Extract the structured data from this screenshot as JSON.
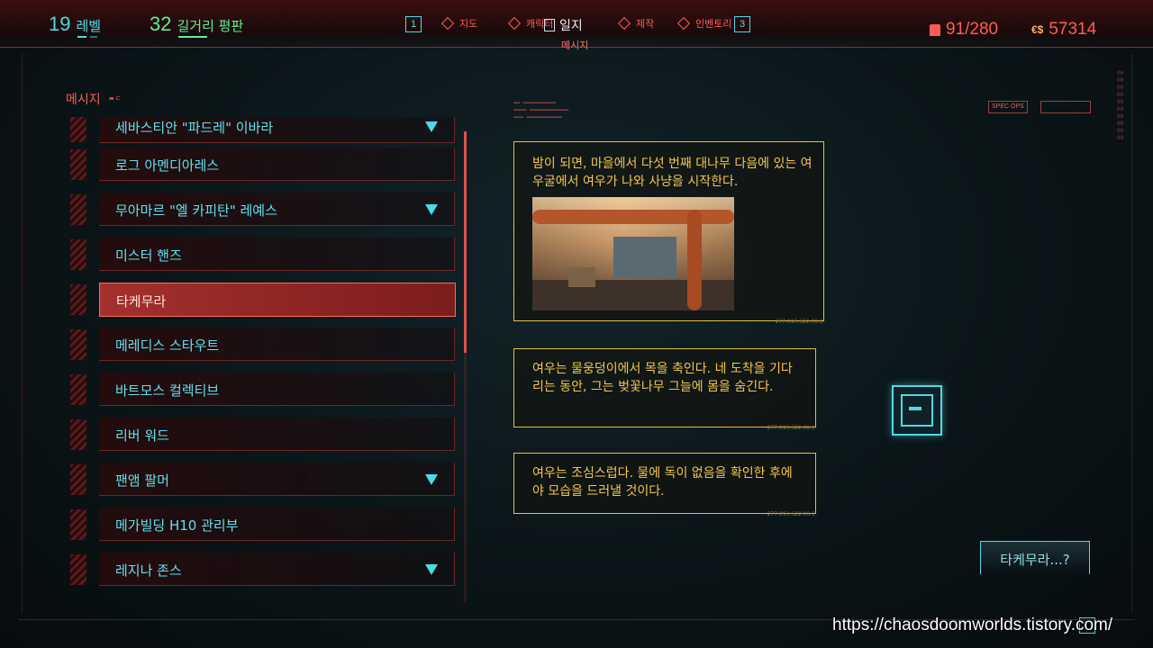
{
  "topbar": {
    "level": {
      "value": "19",
      "label": "레벨"
    },
    "street_cred": {
      "value": "32",
      "label": "길거리 평판"
    },
    "key_left": "1",
    "key_right": "3",
    "nav": [
      {
        "label": "지도",
        "icon": "map-diamond-icon"
      },
      {
        "label": "캐릭터",
        "icon": "character-icon"
      },
      {
        "label": "제작",
        "icon": "crafting-icon"
      },
      {
        "label": "인벤토리",
        "icon": "inventory-icon"
      }
    ],
    "active_tab": "일지",
    "active_sub": "메시지",
    "carry_weight": "91/280",
    "money_symbol": "€$",
    "money": "57314"
  },
  "messages_panel": {
    "title": "메시지",
    "contacts": [
      {
        "name": "세바스티안 \"파드레\" 이바라",
        "has_arrow": true,
        "selected": false
      },
      {
        "name": "로그 아멘디아레스",
        "has_arrow": false,
        "selected": false
      },
      {
        "name": "무아마르 \"엘 카피탄\" 레예스",
        "has_arrow": true,
        "selected": false
      },
      {
        "name": "미스터 핸즈",
        "has_arrow": false,
        "selected": false
      },
      {
        "name": "타케무라",
        "has_arrow": false,
        "selected": true
      },
      {
        "name": "메레디스 스타우트",
        "has_arrow": false,
        "selected": false
      },
      {
        "name": "바트모스 컬렉티브",
        "has_arrow": false,
        "selected": false
      },
      {
        "name": "리버 워드",
        "has_arrow": false,
        "selected": false
      },
      {
        "name": "팬앰 팔머",
        "has_arrow": true,
        "selected": false
      },
      {
        "name": "메가빌딩 H10 관리부",
        "has_arrow": false,
        "selected": false
      },
      {
        "name": "레지나 존스",
        "has_arrow": true,
        "selected": false
      }
    ]
  },
  "conversation": {
    "messages": [
      {
        "text": "밤이 되면, 마을에서 다섯 번째 대나무 다음에 있는 여우굴에서 여우가 나와 사냥을 시작한다.",
        "tag": "277.093.622.00.1"
      },
      {
        "text": "여우는 물웅덩이에서 목을 축인다. 네 도착을 기다리는 동안, 그는 벚꽃나무 그늘에 몸을 숨긴다.",
        "tag": "277.093.622.00.1"
      },
      {
        "text": "여우는 조심스럽다. 물에 독이 없음을 확인한 후에야 모습을 드러낼 것이다.",
        "tag": "277.093.622.00.1"
      }
    ],
    "reply_option": "타케무라...?"
  },
  "deco": {
    "spec_ops": "SPEC OPS"
  },
  "watermark": "https://chaosdoomworlds.tistory.com/",
  "colors": {
    "red": "#ff5c54",
    "cyan": "#4fd9e6",
    "green": "#5ef08f",
    "yellow": "#f3c74b"
  }
}
